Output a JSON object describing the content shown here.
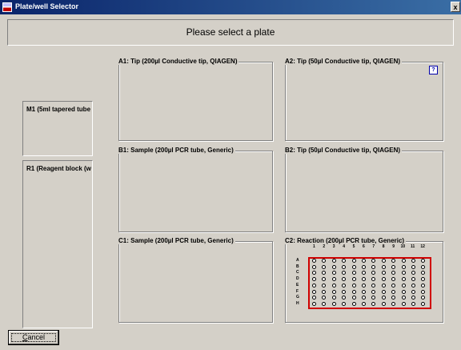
{
  "window": {
    "title": "Plate/well Selector",
    "close_glyph": "x"
  },
  "header": {
    "text": "Please select a plate"
  },
  "side_slots": [
    {
      "label": "M1 (5ml tapered tube"
    },
    {
      "label": "R1 (Reagent block (w"
    }
  ],
  "plates": [
    {
      "id": "A1",
      "label": "A1: Tip (200µl Conductive tip, QIAGEN)"
    },
    {
      "id": "A2",
      "label": "A2: Tip (50µl Conductive tip, QIAGEN)",
      "help_glyph": "?"
    },
    {
      "id": "B1",
      "label": "B1: Sample (200µl PCR tube, Generic)"
    },
    {
      "id": "B2",
      "label": "B2: Tip (50µl Conductive tip, QIAGEN)"
    },
    {
      "id": "C1",
      "label": "C1: Sample (200µl PCR tube, Generic)"
    },
    {
      "id": "C2",
      "label": "C2: Reaction (200µl PCR tube, Generic)"
    }
  ],
  "well_plate": {
    "columns": [
      "1",
      "2",
      "3",
      "4",
      "5",
      "6",
      "7",
      "8",
      "9",
      "10",
      "11",
      "12"
    ],
    "rows": [
      "A",
      "B",
      "C",
      "D",
      "E",
      "F",
      "G",
      "H"
    ],
    "selection_color": "#d00000"
  },
  "buttons": {
    "cancel_label_first": "C",
    "cancel_label_rest": "ancel"
  }
}
